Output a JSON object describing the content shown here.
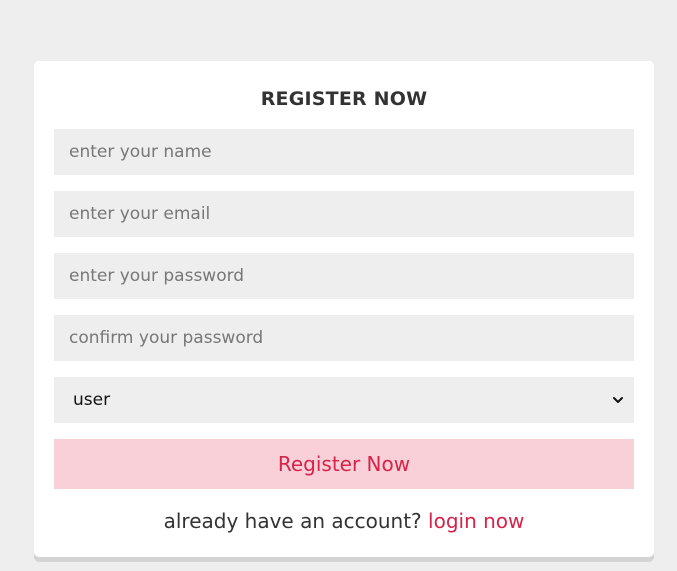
{
  "form": {
    "title": "REGISTER NOW",
    "name_placeholder": "enter your name",
    "email_placeholder": "enter your email",
    "password_placeholder": "enter your password",
    "confirm_placeholder": "confirm your password",
    "role_selected": "user",
    "submit_label": "Register Now",
    "footer_text": "already have an account?",
    "login_link": "login now"
  },
  "colors": {
    "background": "#eeeeee",
    "accent": "#d6234a",
    "button_bg": "#f9d0d8"
  }
}
